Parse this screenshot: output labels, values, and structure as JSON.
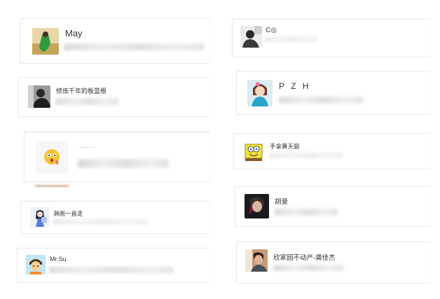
{
  "contacts": [
    {
      "name": "May"
    },
    {
      "name": "C◎"
    },
    {
      "name": "修炼千年的板蓝根"
    },
    {
      "name": "P Z H"
    },
    {
      "name": "......"
    },
    {
      "name": "手拿黄天狼"
    },
    {
      "name": "淋雨一直走"
    },
    {
      "name": "胡斐"
    },
    {
      "name": "Mr.Su"
    },
    {
      "name": "欣家园不动产-龚佳杰"
    }
  ],
  "avatars": [
    "photo-may-green-icon",
    "photo-bw-person-icon",
    "photo-bw-portrait-icon",
    "photo-child-icon",
    "emoji-face-icon",
    "cartoon-sponge-icon",
    "anime-girl-icon",
    "photo-dark-portrait-icon",
    "cartoon-boy-icon",
    "photo-man-icon"
  ]
}
